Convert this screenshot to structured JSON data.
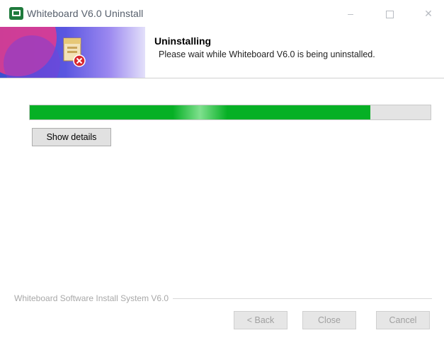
{
  "window": {
    "title": "Whiteboard V6.0 Uninstall",
    "controls": {
      "minimize": "–",
      "close": "✕"
    }
  },
  "header": {
    "title": "Uninstalling",
    "subtitle": "Please wait while Whiteboard V6.0 is being uninstalled."
  },
  "progress": {
    "value_percent": 85,
    "color": "#06b025"
  },
  "buttons": {
    "show_details": "Show details",
    "back": "< Back",
    "close": "Close",
    "cancel": "Cancel"
  },
  "footer": {
    "brand_text": "Whiteboard Software Install System V6.0"
  },
  "colors": {
    "accent_green": "#06b025",
    "header_gradient_start": "#3a4fd0",
    "disabled_text": "#a0a0a0"
  }
}
